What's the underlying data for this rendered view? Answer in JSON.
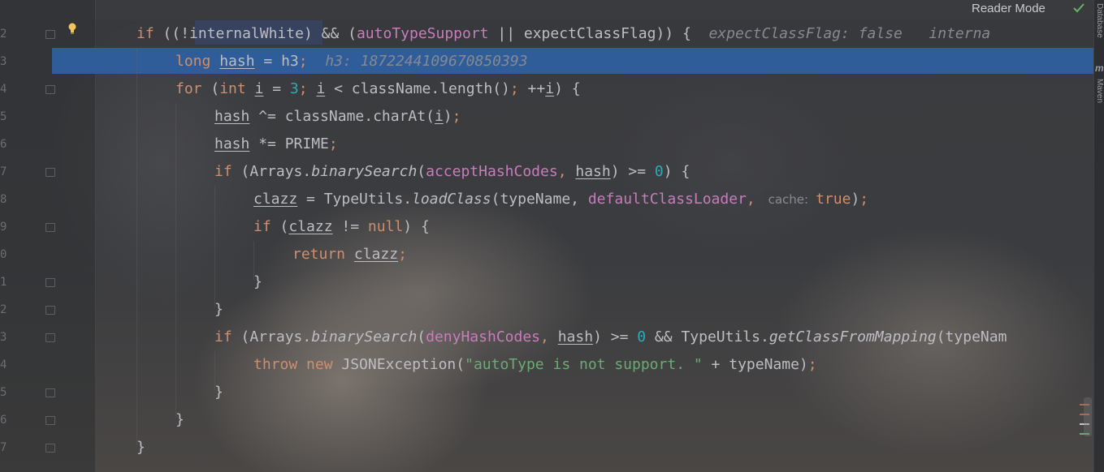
{
  "toolbar": {
    "reader_mode": "Reader Mode"
  },
  "right_tools": {
    "database": "Database",
    "maven": "Maven",
    "m_icon": "m"
  },
  "line_numbers": [
    "2",
    "3",
    "4",
    "5",
    "6",
    "7",
    "8",
    "9",
    "0",
    "1",
    "2",
    "3",
    "4",
    "5",
    "6",
    "7"
  ],
  "code": {
    "l1": {
      "a": "if",
      "b": " ((!",
      "c": "internalWhite",
      "d": ") && (",
      "e": "autoTypeSupport",
      "f": " || expectClassFlag)) {",
      "hint1": "expectClassFlag: false",
      "hint2": "interna"
    },
    "l2": {
      "a": "long",
      "b": " ",
      "c": "hash",
      "d": " = h3",
      "e": ";",
      "hint": "h3: 1872244109670850393"
    },
    "l3": {
      "a": "for",
      "b": " (",
      "c": "int",
      "d": " ",
      "e": "i",
      "f": " = ",
      "g": "3",
      "h": "; ",
      "i": "i",
      "j": " < className.length()",
      "k": ";",
      "l": " ++",
      "m": "i",
      "n": ") {"
    },
    "l4": {
      "a": "hash",
      "b": " ^= className.charAt(",
      "c": "i",
      "d": ")",
      "e": ";"
    },
    "l5": {
      "a": "hash",
      "b": " *= PRIME",
      "c": ";"
    },
    "l6": {
      "a": "if",
      "b": " (Arrays.",
      "c": "binarySearch",
      "d": "(",
      "e": "acceptHashCodes",
      "f": ", ",
      "g": "hash",
      "h": ") >= ",
      "i": "0",
      "j": ") {"
    },
    "l7": {
      "a": "clazz",
      "b": " = TypeUtils.",
      "c": "loadClass",
      "d": "(typeName, ",
      "e": "defaultClassLoader",
      "f": ", ",
      "inlay": "cache:",
      "g": "true",
      "h": ")",
      "i": ";"
    },
    "l8": {
      "a": "if",
      "b": " (",
      "c": "clazz",
      "d": " != ",
      "e": "null",
      "f": ") {"
    },
    "l9": {
      "a": "return",
      "b": " ",
      "c": "clazz",
      "d": ";"
    },
    "l10": {
      "a": "}"
    },
    "l11": {
      "a": "}"
    },
    "l12": {
      "a": "if",
      "b": " (Arrays.",
      "c": "binarySearch",
      "d": "(",
      "e": "denyHashCodes",
      "f": ", ",
      "g": "hash",
      "h": ") >= ",
      "i": "0",
      "j": " && TypeUtils.",
      "k": "getClassFromMapping",
      "l": "(typeNam"
    },
    "l13": {
      "a": "throw",
      "b": " ",
      "c": "new",
      "d": " JSONException(",
      "e": "\"autoType is not support. \"",
      "f": " + typeName)",
      "g": ";"
    },
    "l14": {
      "a": "}"
    },
    "l15": {
      "a": "}"
    },
    "l16": {
      "a": "}"
    }
  },
  "colors": {
    "keyword": "#cf8e6d",
    "field": "#c77dbb",
    "number": "#2aacb8",
    "string": "#6aab73",
    "text": "#bcbec4",
    "selection": "#2f5d99",
    "hint": "#868991"
  },
  "icons": [
    "bulb-icon",
    "check-icon",
    "fold-icon"
  ]
}
